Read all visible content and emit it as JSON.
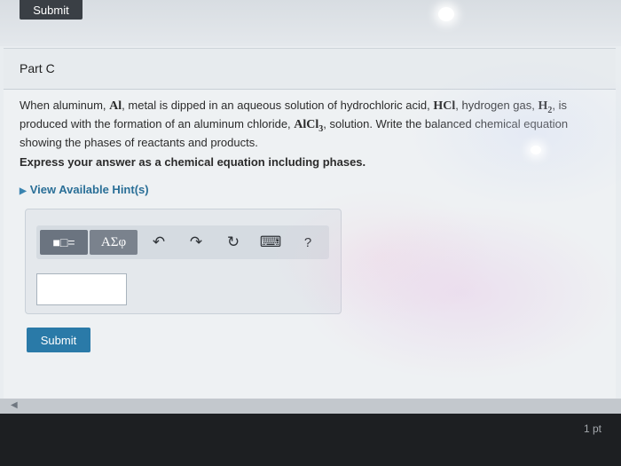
{
  "header": {
    "submit_label": "Submit"
  },
  "part": {
    "title": "Part C"
  },
  "question": {
    "text_1": "When aluminum, ",
    "chem_al": "Al",
    "text_2": ", metal is dipped in an aqueous solution of hydrochloric acid, ",
    "chem_hcl": "HCl",
    "text_3": ", hydrogen gas, ",
    "chem_h": "H",
    "chem_h_sub": "2",
    "text_4": ", is produced with the formation of an aluminum chloride, ",
    "chem_alcl": "AlCl",
    "chem_alcl_sub": "3",
    "text_5": ", solution. Write the balanced chemical equation showing the phases of reactants and products.",
    "instruction": "Express your answer as a chemical equation including phases."
  },
  "hints": {
    "label": "View Available Hint(s)"
  },
  "toolbar": {
    "templates_label": "■□=",
    "greek_label": "ΑΣφ",
    "undo_icon": "↶",
    "redo_icon": "↷",
    "reset_icon": "↻",
    "keyboard_icon": "⌨",
    "help_label": "?"
  },
  "answer": {
    "value": ""
  },
  "actions": {
    "submit_label": "Submit"
  },
  "footer": {
    "points": "1 pt"
  }
}
